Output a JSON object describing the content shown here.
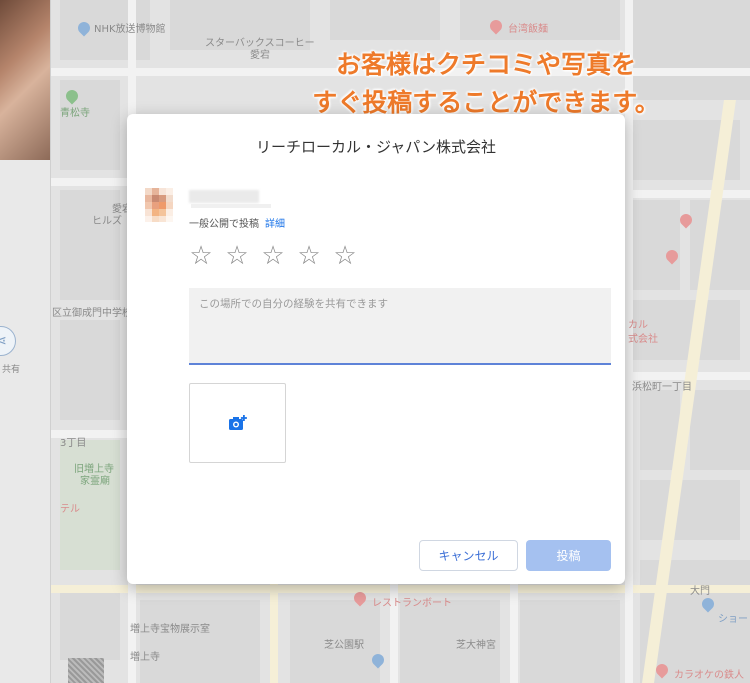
{
  "promo": {
    "line1": "お客様はクチコミや写真を",
    "line2": "すぐ投稿することができます。",
    "color": "#ee7a2a"
  },
  "dialog": {
    "title": "リーチローカル・ジャパン株式会社",
    "privacy_text": "一般公開で投稿",
    "privacy_link": "詳細",
    "rating_stars": 5,
    "rating_value": 0,
    "review_placeholder": "この場所での自分の経験を共有できます",
    "add_photo_icon": "add-photo-icon",
    "cancel_label": "キャンセル",
    "post_label": "投稿",
    "accent_color": "#1a73e8"
  },
  "map": {
    "labels": {
      "nhk": "NHK放送博物館",
      "starbucks": "スターバックスコーヒー",
      "station": "愛宕",
      "aomatsu": "青松寺",
      "ataqo": "愛宕",
      "hills": "ヒルズ",
      "school": "区立御成門中学校",
      "three_chome": "3丁目",
      "zojoji_old": "旧増上寺",
      "grave": "家霊廟",
      "hotel": "テル",
      "zojoji_house": "増上寺宝物展示室",
      "zojoji": "増上寺",
      "daimon": "大門",
      "shiba_park": "芝公園駅",
      "shiba_shrine": "芝大神宮",
      "restaurant": "レストランボート",
      "karaoke": "カラオケの鉄人",
      "taiwan": "台湾飯麺",
      "hamamatsucho": "浜松町一丁目",
      "local": "カル",
      "company": "式会社",
      "shoe": "ショー"
    },
    "side_labels": {
      "share": "共有"
    }
  }
}
